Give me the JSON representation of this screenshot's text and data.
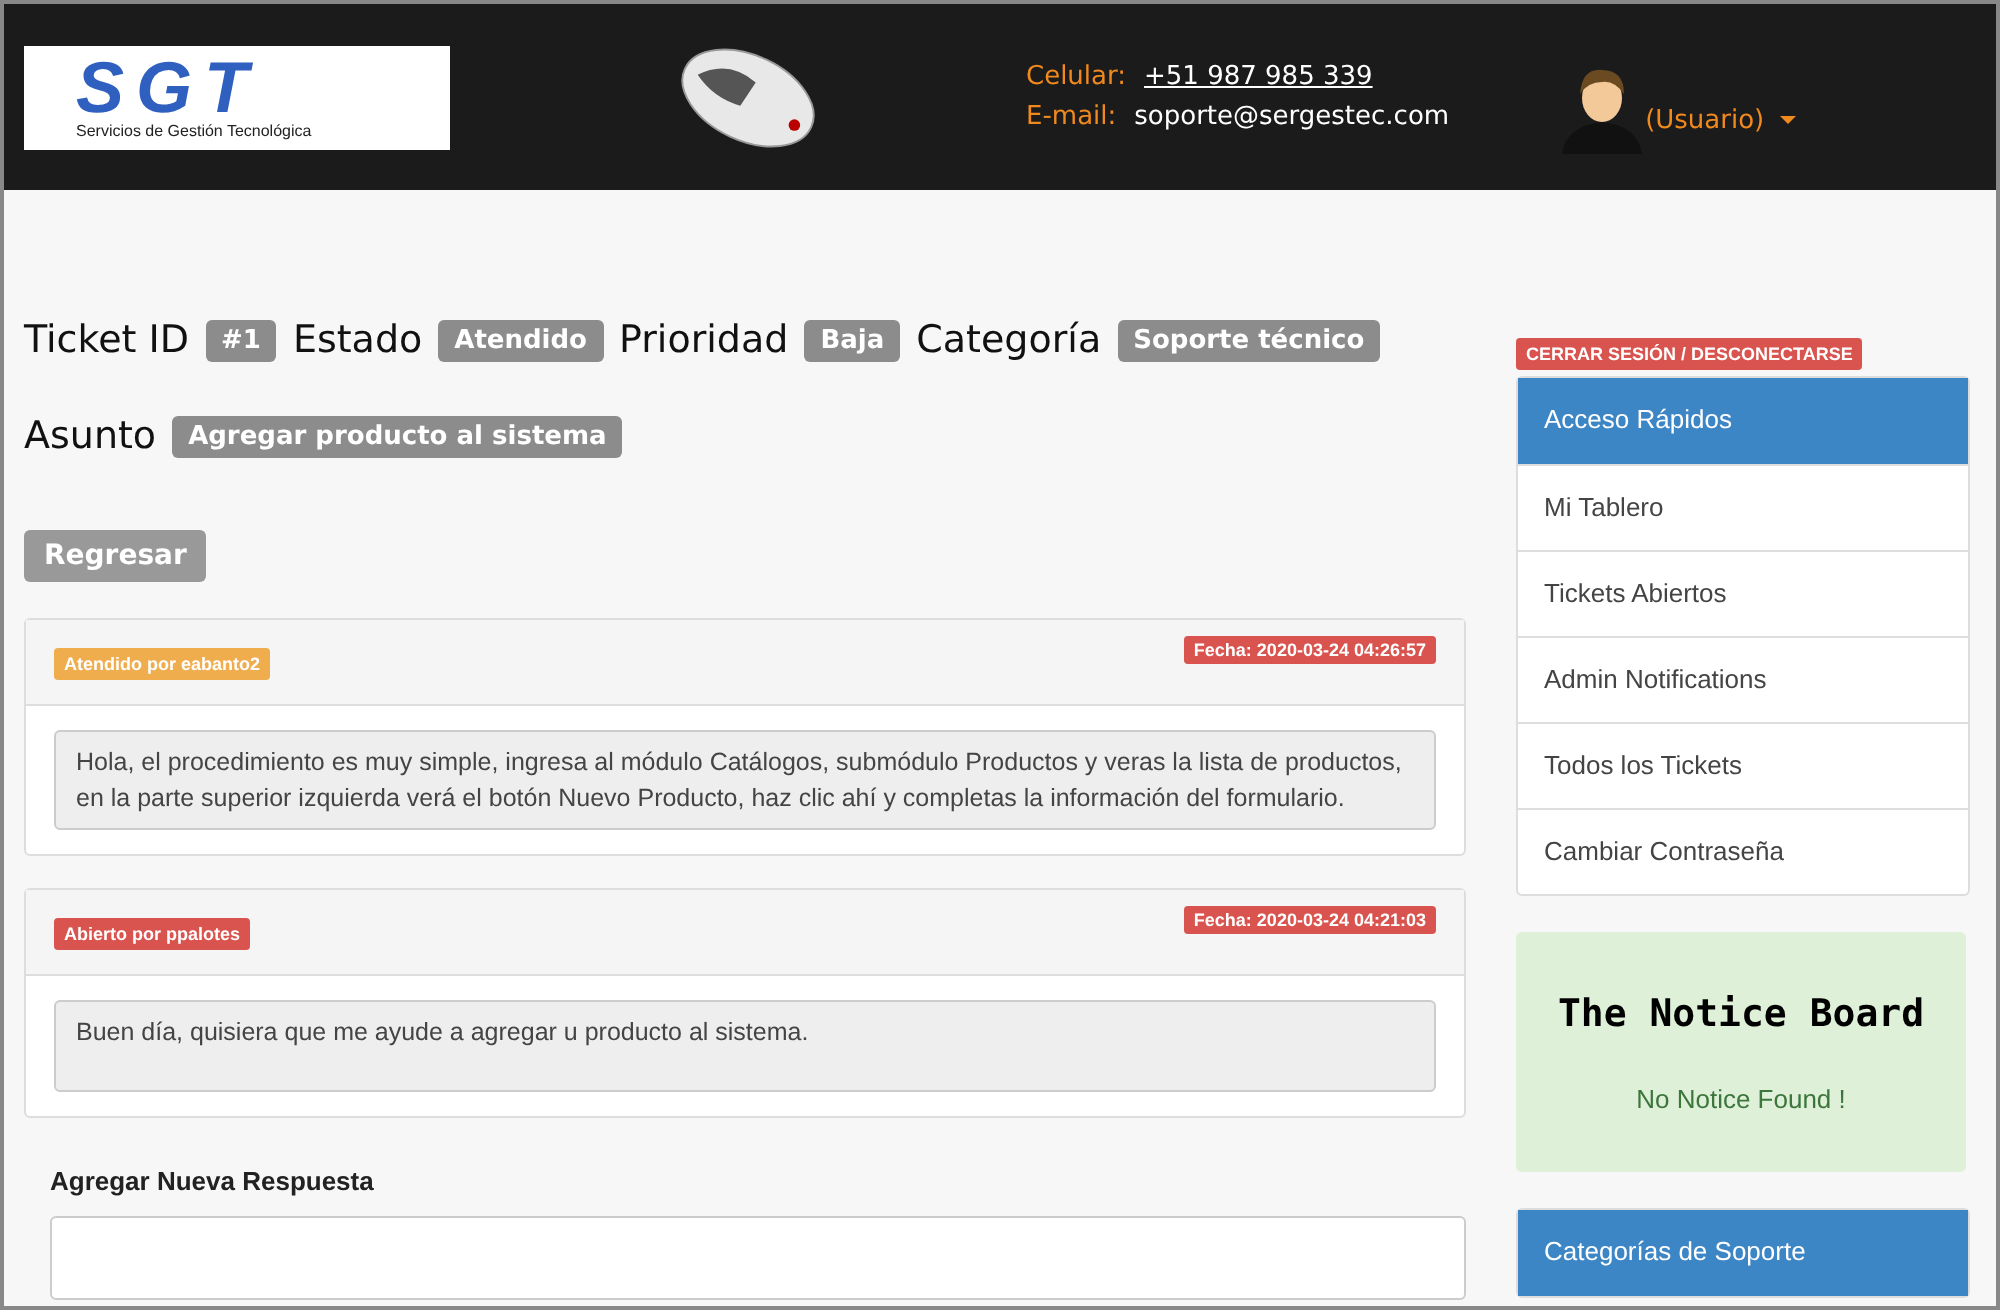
{
  "header": {
    "logo": {
      "mark": "SGT",
      "subtitle": "Servicios de Gestión Tecnológica"
    },
    "contact": [
      {
        "label": "Celular:",
        "value": "+51 987 985 339",
        "link": true
      },
      {
        "label": "E-mail:",
        "value": "soporte@sergestec.com",
        "link": false
      }
    ],
    "user": "(Usuario)"
  },
  "ticket": {
    "fields": [
      {
        "label": "Ticket ID",
        "value": "#1"
      },
      {
        "label": "Estado",
        "value": "Atendido"
      },
      {
        "label": "Prioridad",
        "value": "Baja"
      },
      {
        "label": "Categoría",
        "value": "Soporte técnico"
      }
    ],
    "subject": {
      "label": "Asunto",
      "value": "Agregar producto al sistema"
    },
    "back_button": "Regresar"
  },
  "messages": [
    {
      "author": "Atendido por eabanto2",
      "color": "#f0ad4e",
      "date": "Fecha: 2020-03-24 04:26:57",
      "text": "Hola, el procedimiento es muy simple, ingresa al módulo Catálogos, submódulo Productos y veras la lista de productos, en la parte superior izquierda verá el botón Nuevo Producto, haz clic ahí y completas la información del formulario."
    },
    {
      "author": "Abierto por ppalotes",
      "color": "#d9534f",
      "date": "Fecha: 2020-03-24 04:21:03",
      "text": "Buen día, quisiera que me ayude a agregar u producto al sistema."
    }
  ],
  "reply": {
    "label": "Agregar Nueva Respuesta"
  },
  "sidebar": {
    "logout": "CERRAR SESIÓN / DESCONECTARSE",
    "quick_access": {
      "title": "Acceso Rápidos",
      "items": [
        "Mi Tablero",
        "Tickets Abiertos",
        "Admin Notifications",
        "Todos los Tickets",
        "Cambiar Contraseña"
      ]
    },
    "notice_board": {
      "title": "The Notice Board",
      "message": "No Notice Found !"
    },
    "categories": {
      "title": "Categorías de Soporte"
    }
  }
}
